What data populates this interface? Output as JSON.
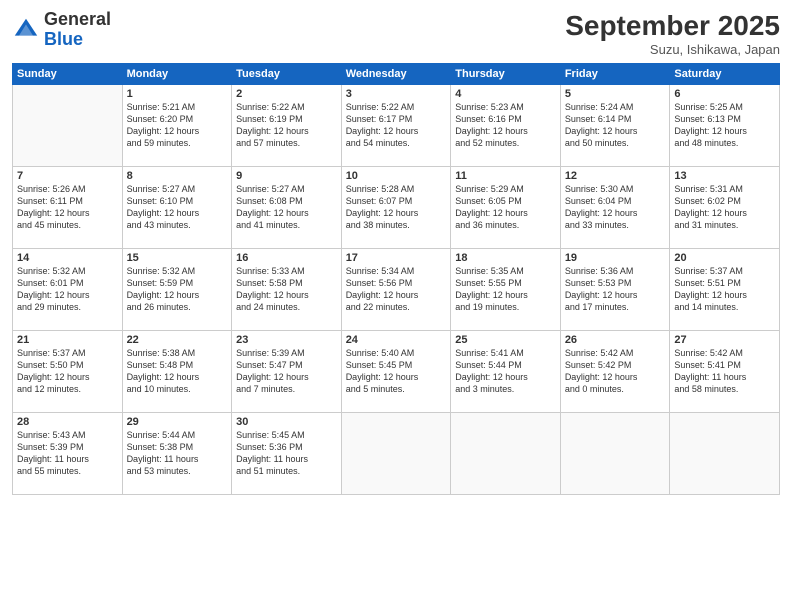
{
  "header": {
    "logo_line1": "General",
    "logo_line2": "Blue",
    "month": "September 2025",
    "location": "Suzu, Ishikawa, Japan"
  },
  "weekdays": [
    "Sunday",
    "Monday",
    "Tuesday",
    "Wednesday",
    "Thursday",
    "Friday",
    "Saturday"
  ],
  "weeks": [
    [
      {
        "day": "",
        "info": ""
      },
      {
        "day": "1",
        "info": "Sunrise: 5:21 AM\nSunset: 6:20 PM\nDaylight: 12 hours\nand 59 minutes."
      },
      {
        "day": "2",
        "info": "Sunrise: 5:22 AM\nSunset: 6:19 PM\nDaylight: 12 hours\nand 57 minutes."
      },
      {
        "day": "3",
        "info": "Sunrise: 5:22 AM\nSunset: 6:17 PM\nDaylight: 12 hours\nand 54 minutes."
      },
      {
        "day": "4",
        "info": "Sunrise: 5:23 AM\nSunset: 6:16 PM\nDaylight: 12 hours\nand 52 minutes."
      },
      {
        "day": "5",
        "info": "Sunrise: 5:24 AM\nSunset: 6:14 PM\nDaylight: 12 hours\nand 50 minutes."
      },
      {
        "day": "6",
        "info": "Sunrise: 5:25 AM\nSunset: 6:13 PM\nDaylight: 12 hours\nand 48 minutes."
      }
    ],
    [
      {
        "day": "7",
        "info": "Sunrise: 5:26 AM\nSunset: 6:11 PM\nDaylight: 12 hours\nand 45 minutes."
      },
      {
        "day": "8",
        "info": "Sunrise: 5:27 AM\nSunset: 6:10 PM\nDaylight: 12 hours\nand 43 minutes."
      },
      {
        "day": "9",
        "info": "Sunrise: 5:27 AM\nSunset: 6:08 PM\nDaylight: 12 hours\nand 41 minutes."
      },
      {
        "day": "10",
        "info": "Sunrise: 5:28 AM\nSunset: 6:07 PM\nDaylight: 12 hours\nand 38 minutes."
      },
      {
        "day": "11",
        "info": "Sunrise: 5:29 AM\nSunset: 6:05 PM\nDaylight: 12 hours\nand 36 minutes."
      },
      {
        "day": "12",
        "info": "Sunrise: 5:30 AM\nSunset: 6:04 PM\nDaylight: 12 hours\nand 33 minutes."
      },
      {
        "day": "13",
        "info": "Sunrise: 5:31 AM\nSunset: 6:02 PM\nDaylight: 12 hours\nand 31 minutes."
      }
    ],
    [
      {
        "day": "14",
        "info": "Sunrise: 5:32 AM\nSunset: 6:01 PM\nDaylight: 12 hours\nand 29 minutes."
      },
      {
        "day": "15",
        "info": "Sunrise: 5:32 AM\nSunset: 5:59 PM\nDaylight: 12 hours\nand 26 minutes."
      },
      {
        "day": "16",
        "info": "Sunrise: 5:33 AM\nSunset: 5:58 PM\nDaylight: 12 hours\nand 24 minutes."
      },
      {
        "day": "17",
        "info": "Sunrise: 5:34 AM\nSunset: 5:56 PM\nDaylight: 12 hours\nand 22 minutes."
      },
      {
        "day": "18",
        "info": "Sunrise: 5:35 AM\nSunset: 5:55 PM\nDaylight: 12 hours\nand 19 minutes."
      },
      {
        "day": "19",
        "info": "Sunrise: 5:36 AM\nSunset: 5:53 PM\nDaylight: 12 hours\nand 17 minutes."
      },
      {
        "day": "20",
        "info": "Sunrise: 5:37 AM\nSunset: 5:51 PM\nDaylight: 12 hours\nand 14 minutes."
      }
    ],
    [
      {
        "day": "21",
        "info": "Sunrise: 5:37 AM\nSunset: 5:50 PM\nDaylight: 12 hours\nand 12 minutes."
      },
      {
        "day": "22",
        "info": "Sunrise: 5:38 AM\nSunset: 5:48 PM\nDaylight: 12 hours\nand 10 minutes."
      },
      {
        "day": "23",
        "info": "Sunrise: 5:39 AM\nSunset: 5:47 PM\nDaylight: 12 hours\nand 7 minutes."
      },
      {
        "day": "24",
        "info": "Sunrise: 5:40 AM\nSunset: 5:45 PM\nDaylight: 12 hours\nand 5 minutes."
      },
      {
        "day": "25",
        "info": "Sunrise: 5:41 AM\nSunset: 5:44 PM\nDaylight: 12 hours\nand 3 minutes."
      },
      {
        "day": "26",
        "info": "Sunrise: 5:42 AM\nSunset: 5:42 PM\nDaylight: 12 hours\nand 0 minutes."
      },
      {
        "day": "27",
        "info": "Sunrise: 5:42 AM\nSunset: 5:41 PM\nDaylight: 11 hours\nand 58 minutes."
      }
    ],
    [
      {
        "day": "28",
        "info": "Sunrise: 5:43 AM\nSunset: 5:39 PM\nDaylight: 11 hours\nand 55 minutes."
      },
      {
        "day": "29",
        "info": "Sunrise: 5:44 AM\nSunset: 5:38 PM\nDaylight: 11 hours\nand 53 minutes."
      },
      {
        "day": "30",
        "info": "Sunrise: 5:45 AM\nSunset: 5:36 PM\nDaylight: 11 hours\nand 51 minutes."
      },
      {
        "day": "",
        "info": ""
      },
      {
        "day": "",
        "info": ""
      },
      {
        "day": "",
        "info": ""
      },
      {
        "day": "",
        "info": ""
      }
    ]
  ]
}
